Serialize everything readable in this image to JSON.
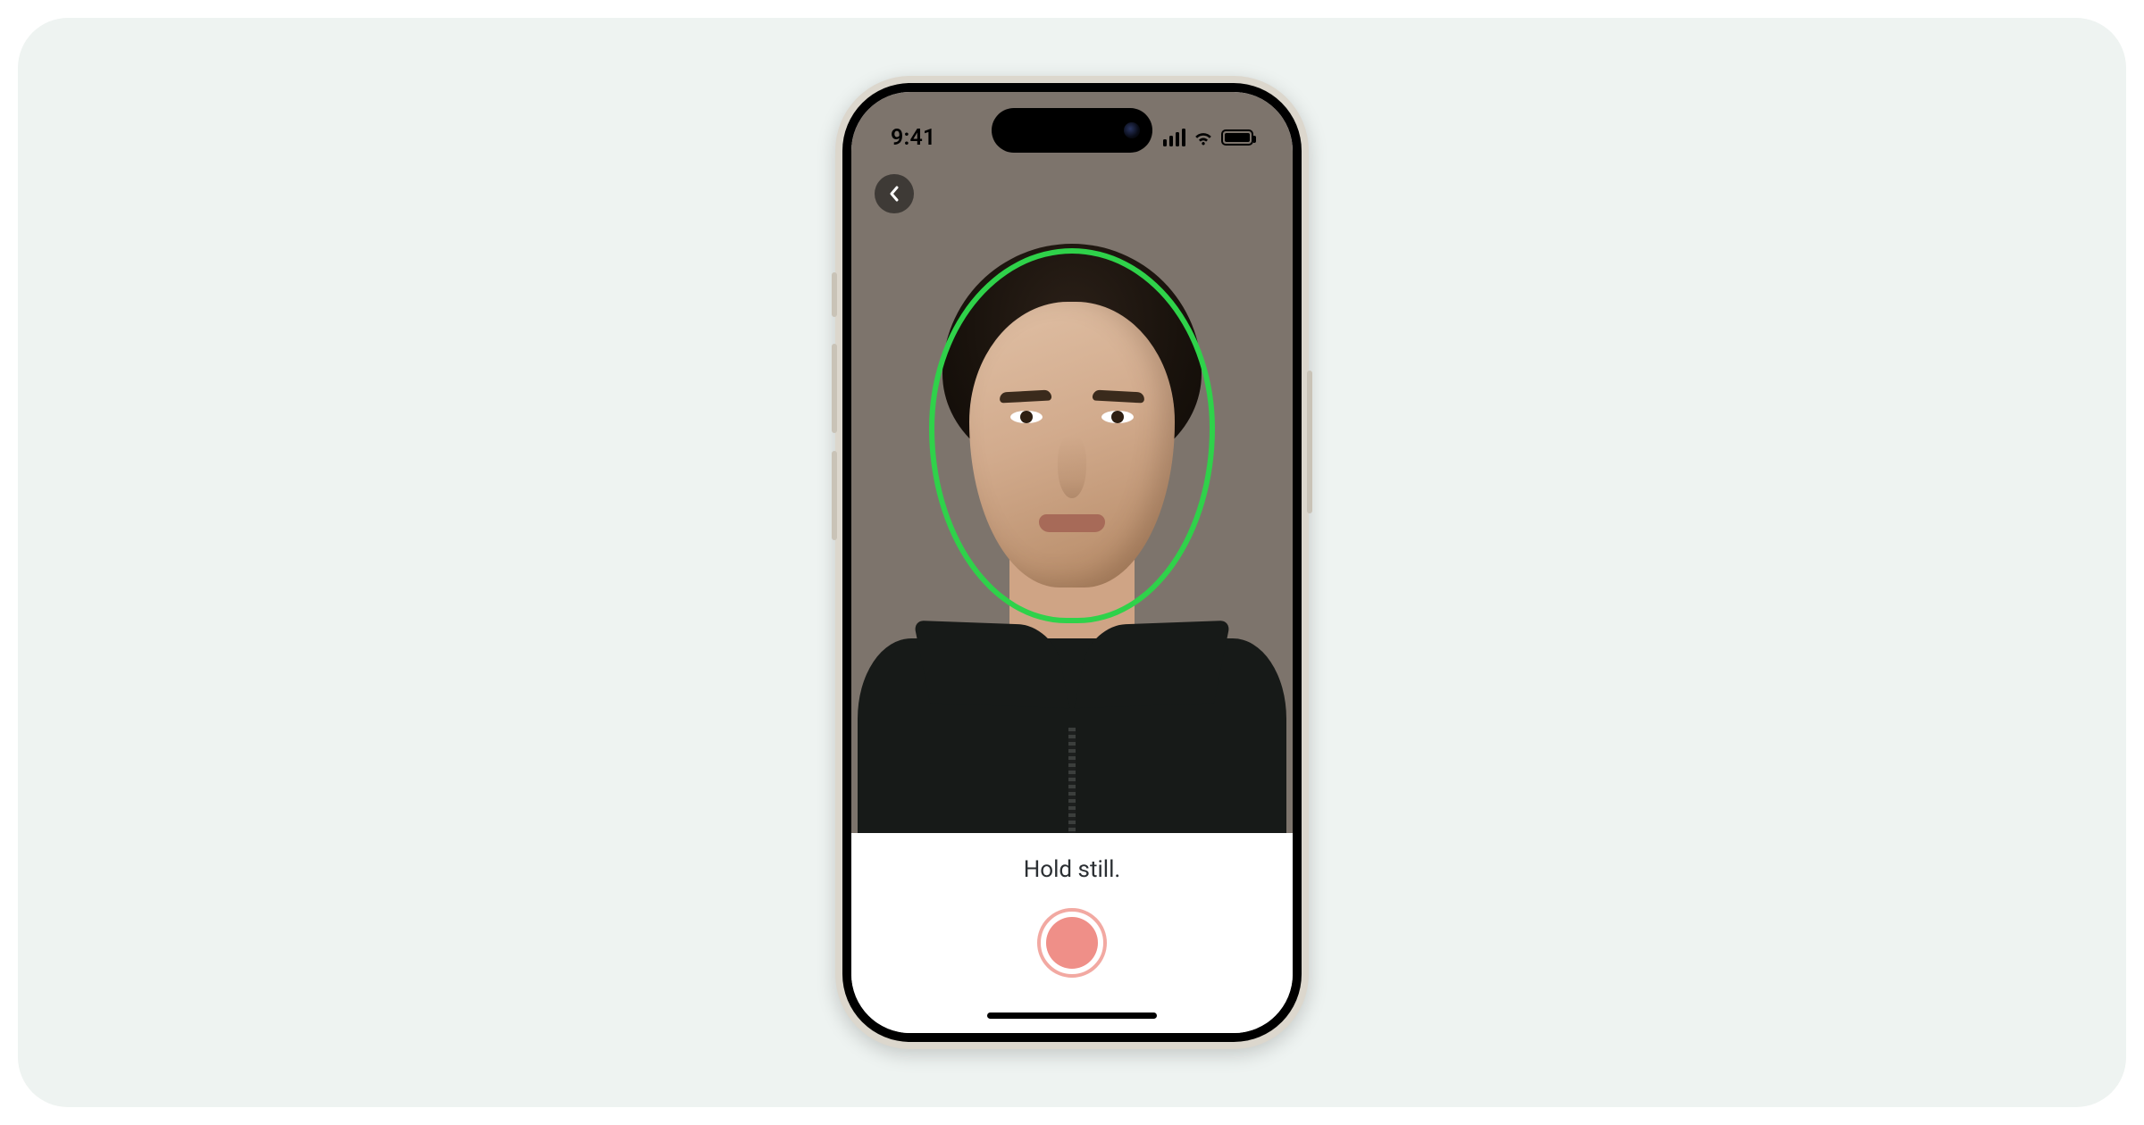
{
  "statusBar": {
    "time": "9:41"
  },
  "camera": {
    "instruction": "Hold still.",
    "faceDetected": true,
    "ovalColor": "#2fd24a"
  },
  "buttons": {
    "back": "Back",
    "capture": "Capture"
  },
  "colors": {
    "stageBackground": "#eef3f1",
    "captureAccent": "#ef8f88"
  }
}
